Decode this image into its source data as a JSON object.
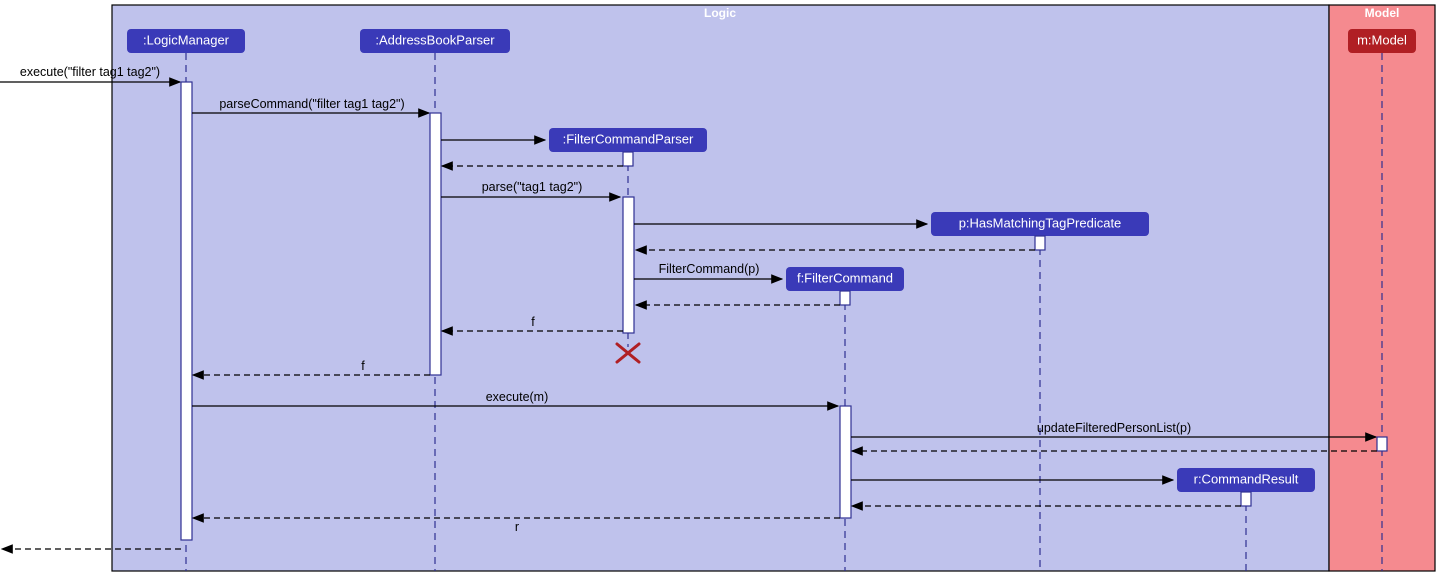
{
  "frames": {
    "logic": {
      "label": "Logic"
    },
    "model": {
      "label": "Model"
    }
  },
  "participants": {
    "logicManager": {
      "label": ":LogicManager"
    },
    "addressBookParser": {
      "label": ":AddressBookParser"
    },
    "filterCommandParser": {
      "label": ":FilterCommandParser"
    },
    "hasMatchingTagPredicate": {
      "label": "p:HasMatchingTagPredicate"
    },
    "filterCommand": {
      "label": "f:FilterCommand"
    },
    "commandResult": {
      "label": "r:CommandResult"
    },
    "model": {
      "label": "m:Model"
    }
  },
  "messages": {
    "executeIn": "execute(\"filter tag1 tag2\")",
    "parseCommand": "parseCommand(\"filter tag1 tag2\")",
    "parse": "parse(\"tag1 tag2\")",
    "filterCommandNew": "FilterCommand(p)",
    "returnF1": "f",
    "returnF2": "f",
    "executeM": "execute(m)",
    "updateFilteredPersonList": "updateFilteredPersonList(p)",
    "returnR": "r"
  }
}
